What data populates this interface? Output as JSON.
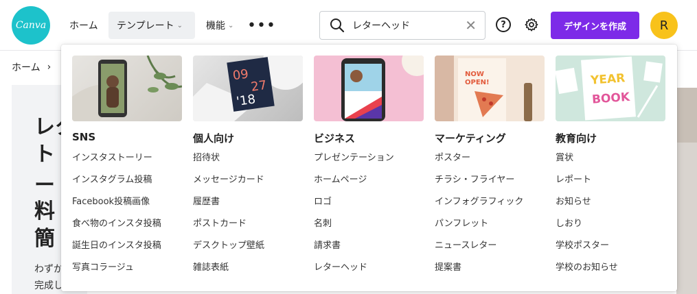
{
  "header": {
    "logo_text": "Canva",
    "nav": {
      "home": "ホーム",
      "templates": "テンプレート",
      "features": "機能",
      "more": "•••"
    },
    "search": {
      "value": "レターヘッド",
      "placeholder": ""
    },
    "help": "?",
    "create_button": "デザインを作成",
    "avatar_initial": "R",
    "colors": {
      "brand_teal": "#1dc2cb",
      "create_purple": "#7d2ae8",
      "avatar_yellow": "#f8c21b"
    }
  },
  "page": {
    "breadcrumb": "ホーム",
    "hero_lines": [
      "レタ",
      "ト",
      "ー",
      "料",
      "簡"
    ],
    "hero_sub": [
      "わずか",
      "完成し"
    ]
  },
  "dropdown": {
    "columns": [
      {
        "title": "SNS",
        "thumb": "phone-story-thumbnail",
        "links": [
          "インスタストーリー",
          "インスタグラム投稿",
          "Facebook投稿画像",
          "食べ物のインスタ投稿",
          "誕生日のインスタ投稿",
          "写真コラージュ"
        ]
      },
      {
        "title": "個人向け",
        "thumb": "calendar-card-thumbnail",
        "thumb_text": [
          "09",
          "27",
          "'18"
        ],
        "links": [
          "招待状",
          "メッセージカード",
          "履歴書",
          "ポストカード",
          "デスクトップ壁紙",
          "雑誌表紙"
        ]
      },
      {
        "title": "ビジネス",
        "thumb": "phone-presentation-thumbnail",
        "links": [
          "プレゼンテーション",
          "ホームページ",
          "ロゴ",
          "名刺",
          "請求書",
          "レターヘッド"
        ]
      },
      {
        "title": "マーケティング",
        "thumb": "flyer-thumbnail",
        "thumb_text": [
          "NOW",
          "OPEN!"
        ],
        "links": [
          "ポスター",
          "チラシ・フライヤー",
          "インフォグラフィック",
          "パンフレット",
          "ニュースレター",
          "提案書"
        ]
      },
      {
        "title": "教育向け",
        "thumb": "yearbook-thumbnail",
        "thumb_text": [
          "YEAR",
          "BOOK"
        ],
        "links": [
          "賞状",
          "レポート",
          "お知らせ",
          "しおり",
          "学校ポスター",
          "学校のお知らせ"
        ]
      }
    ]
  }
}
